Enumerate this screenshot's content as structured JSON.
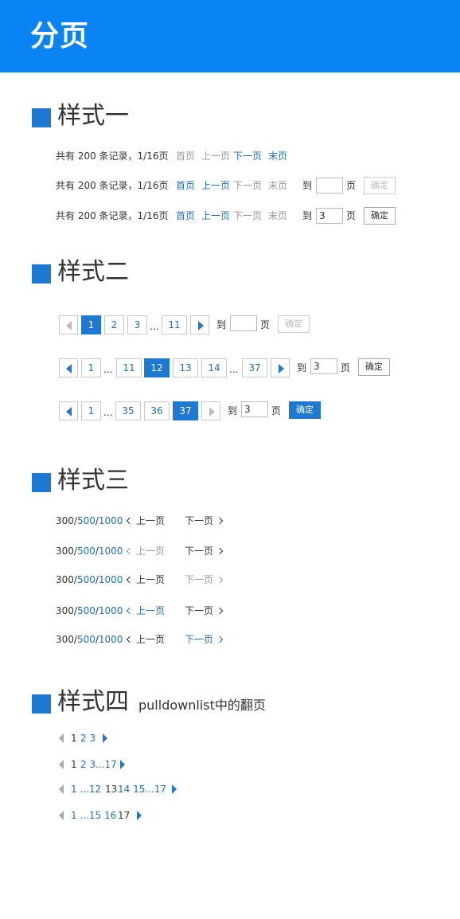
{
  "header": {
    "title": "分页"
  },
  "sections": {
    "s1": {
      "title": "样式一"
    },
    "s2": {
      "title": "样式二"
    },
    "s3": {
      "title": "样式三"
    },
    "s4": {
      "title": "样式四",
      "subtitle": "pulldownlist中的翻页"
    }
  },
  "style1": {
    "summary": "共有 200 条记录，1/16页",
    "first": "首页",
    "prev": "上一页",
    "next": "下一页",
    "last": "末页",
    "goto": "到",
    "page_unit": "页",
    "confirm": "确定",
    "row3_value": "3"
  },
  "style2": {
    "goto": "到",
    "page_unit": "页",
    "confirm": "确定",
    "ellipsis": "...",
    "row1": {
      "pages": [
        "1",
        "2",
        "3",
        "11"
      ],
      "input": ""
    },
    "row2": {
      "pages": [
        "1",
        "11",
        "12",
        "13",
        "14",
        "37"
      ],
      "input": "3"
    },
    "row3": {
      "pages": [
        "1",
        "35",
        "36",
        "37"
      ],
      "input": "3"
    }
  },
  "style3": {
    "n1": "300",
    "n2": "500",
    "n3": "1000",
    "sep": "/",
    "prev": "上一页",
    "next": "下一页"
  },
  "style4": {
    "row1": {
      "a": "1",
      "b": "2 3"
    },
    "row2": {
      "a": "1",
      "b": "2 3...17"
    },
    "row3": {
      "a": "1 ...12",
      "b": "13",
      "c": "14 15...17"
    },
    "row4": {
      "a": "1 ...15 16",
      "b": "17"
    }
  },
  "colors": {
    "header_bg": "#0a84f4",
    "accent": "#1f78d1",
    "link": "#1f6fc4",
    "disabled": "#999999"
  }
}
